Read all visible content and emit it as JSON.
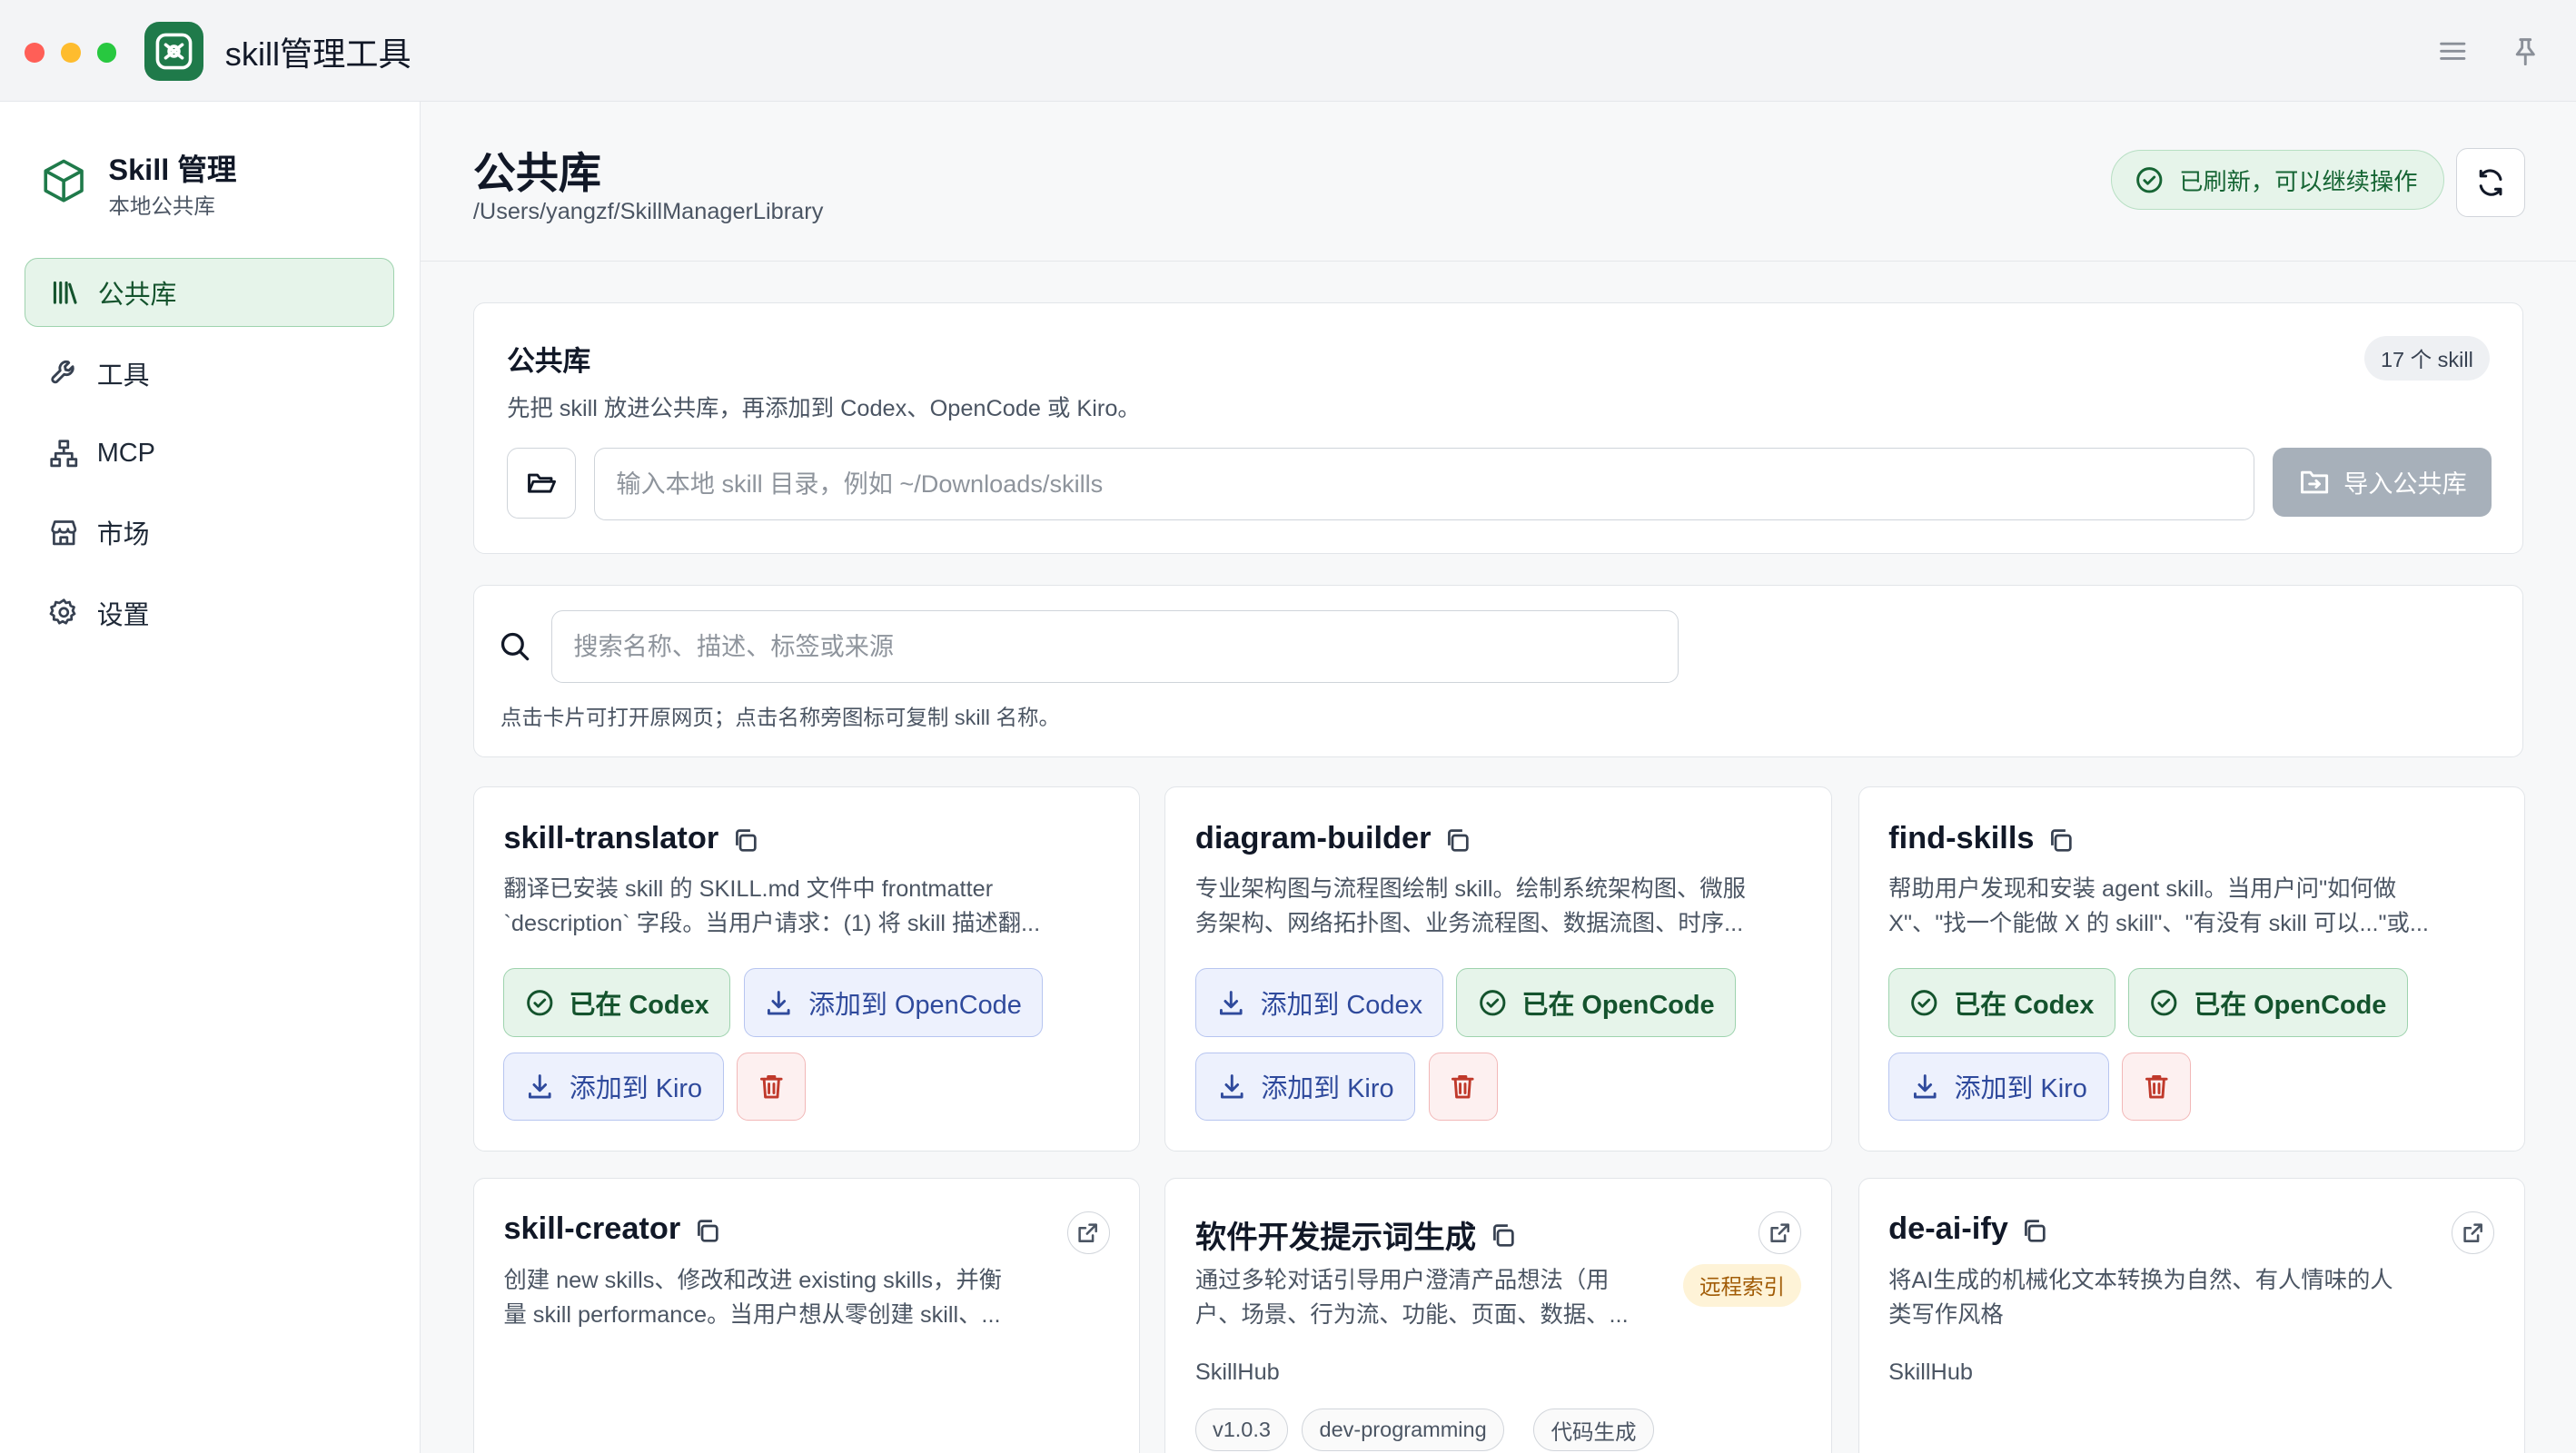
{
  "window": {
    "title": "skill管理工具"
  },
  "sidebar": {
    "brand_title": "Skill 管理",
    "brand_subtitle": "本地公共库",
    "items": [
      {
        "label": "公共库",
        "icon": "library-icon",
        "active": true
      },
      {
        "label": "工具",
        "icon": "wrench-icon",
        "active": false
      },
      {
        "label": "MCP",
        "icon": "network-icon",
        "active": false
      },
      {
        "label": "市场",
        "icon": "store-icon",
        "active": false
      },
      {
        "label": "设置",
        "icon": "gear-icon",
        "active": false
      }
    ]
  },
  "header": {
    "title": "公共库",
    "path": "/Users/yangzf/SkillManagerLibrary",
    "status": "已刷新，可以继续操作"
  },
  "import_panel": {
    "title": "公共库",
    "description": "先把 skill 放进公共库，再添加到 Codex、OpenCode 或 Kiro。",
    "count": "17 个 skill",
    "input_placeholder": "输入本地 skill 目录，例如 ~/Downloads/skills",
    "input_value": "",
    "import_label": "导入公共库"
  },
  "search_panel": {
    "placeholder": "搜索名称、描述、标签或来源",
    "value": "",
    "hint": "点击卡片可打开原网页；点击名称旁图标可复制 skill 名称。"
  },
  "colors": {
    "accent": "#1f7a4a",
    "installed_bg": "#e6f4ea",
    "add_bg": "#edf1fd",
    "danger": "#c0392b",
    "remote_badge": "#fef3d7"
  },
  "cards": [
    {
      "name": "skill-translator",
      "desc_line1": "翻译已安装 skill 的 SKILL.md 文件中 frontmatter",
      "desc_line2": "`description` 字段。当用户请求：(1) 将 skill 描述翻...",
      "btn1": "已在 Codex",
      "btn2": "添加到 OpenCode",
      "btn3": "添加到 Kiro"
    },
    {
      "name": "diagram-builder",
      "desc_line1": "专业架构图与流程图绘制 skill。绘制系统架构图、微服",
      "desc_line2": "务架构、网络拓扑图、业务流程图、数据流图、时序...",
      "btn1": "添加到 Codex",
      "btn2": "已在 OpenCode",
      "btn3": "添加到 Kiro"
    },
    {
      "name": "find-skills",
      "desc_line1": "帮助用户发现和安装 agent skill。当用户问\"如何做",
      "desc_line2": "X\"、\"找一个能做 X 的 skill\"、\"有没有 skill 可以...\"或...",
      "btn1": "已在 Codex",
      "btn2": "已在 OpenCode",
      "btn3": "添加到 Kiro"
    },
    {
      "name": "skill-creator",
      "desc_line1": "创建 new skills、修改和改进 existing skills，并衡",
      "desc_line2": "量 skill performance。当用户想从零创建 skill、..."
    },
    {
      "name": "软件开发提示词生成",
      "desc_line1": "通过多轮对话引导用户澄清产品想法（用",
      "desc_line2": "户、场景、行为流、功能、页面、数据、...",
      "badge": "远程索引",
      "source": "SkillHub",
      "tags": [
        "v1.0.3",
        "dev-programming",
        "代码生成"
      ]
    },
    {
      "name": "de-ai-ify",
      "desc_line1": "将AI生成的机械化文本转换为自然、有人情味的人",
      "desc_line2": "类写作风格",
      "source": "SkillHub"
    }
  ]
}
